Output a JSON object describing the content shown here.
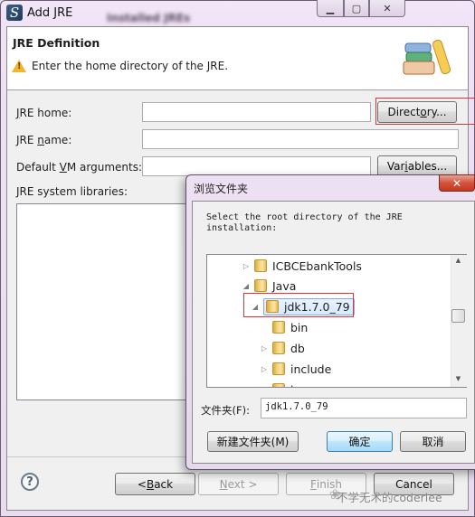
{
  "window": {
    "title": "Add JRE",
    "background_title": "Installed JREs",
    "minimize_glyph": "▁",
    "maximize_glyph": "▢",
    "close_glyph": "✕"
  },
  "header": {
    "title": "JRE Definition",
    "message": "Enter the home directory of the JRE.",
    "warning_glyph": "!"
  },
  "form": {
    "jre_home": {
      "label_pre": "",
      "label_mnemonic": "J",
      "label_post": "RE home:",
      "value": ""
    },
    "jre_name": {
      "label_pre": "JRE ",
      "label_mnemonic": "n",
      "label_post": "ame:",
      "value": ""
    },
    "vm_args": {
      "label_pre": "Default ",
      "label_mnemonic": "V",
      "label_post": "M arguments:",
      "value": ""
    },
    "libraries_label": "JRE system libraries:",
    "directory_button": {
      "pre": "Direct",
      "mnemonic": "o",
      "post": "ry..."
    },
    "variables_button": {
      "pre": "Var",
      "mnemonic": "i",
      "post": "ables..."
    }
  },
  "footer": {
    "help_glyph": "?",
    "back": {
      "pre": "< ",
      "mnemonic": "B",
      "post": "ack"
    },
    "next": {
      "pre": "",
      "mnemonic": "N",
      "post": "ext >"
    },
    "finish": {
      "pre": "",
      "mnemonic": "F",
      "post": "inish"
    },
    "cancel": "Cancel"
  },
  "browse_dialog": {
    "title": "浏览文件夹",
    "close_glyph": "✕",
    "prompt": "Select the root directory of the JRE installation:",
    "tree": [
      {
        "label": "ICBCEbankTools",
        "expander": "▷",
        "level": 0,
        "selected": false
      },
      {
        "label": "Java",
        "expander": "◢",
        "level": 0,
        "selected": false
      },
      {
        "label": "jdk1.7.0_79",
        "expander": "◢",
        "level": 1,
        "selected": true
      },
      {
        "label": "bin",
        "expander": "",
        "level": 2,
        "selected": false
      },
      {
        "label": "db",
        "expander": "▷",
        "level": 2,
        "selected": false
      },
      {
        "label": "include",
        "expander": "▷",
        "level": 2,
        "selected": false
      },
      {
        "label": "j...",
        "expander": "▷",
        "level": 2,
        "selected": false
      }
    ],
    "scroll_up_glyph": "▲",
    "scroll_down_glyph": "▼",
    "folder_label": "文件夹(F):",
    "folder_value": "jdk1.7.0_79",
    "new_folder_button": "新建文件夹(M)",
    "ok_button": "确定",
    "cancel_button": "取消"
  },
  "watermark": {
    "icon": "❀",
    "text": "不学无术的coderlee"
  },
  "colors": {
    "highlight_box": "#d9363e",
    "selection_border": "#84acdd",
    "default_button_border": "#3c7fb1"
  }
}
